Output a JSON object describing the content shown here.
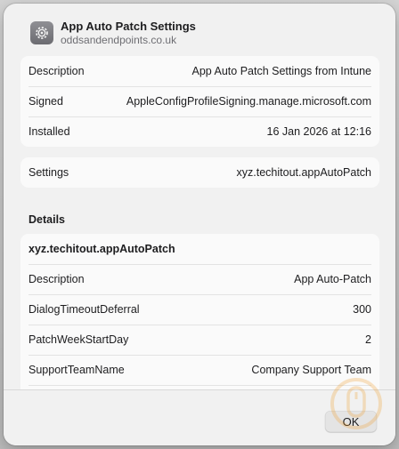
{
  "dialog": {
    "title": "App Auto Patch Settings",
    "subtitle": "oddsandendpoints.co.uk",
    "icon": "gear-icon"
  },
  "profile": {
    "rows": [
      {
        "label": "Description",
        "value": "App Auto Patch Settings from Intune"
      },
      {
        "label": "Signed",
        "value": "AppleConfigProfileSigning.manage.microsoft.com"
      },
      {
        "label": "Installed",
        "value": "16 Jan 2026 at 12:16"
      }
    ]
  },
  "settings": {
    "label": "Settings",
    "value": "xyz.techitout.appAutoPatch"
  },
  "details": {
    "section_title": "Details",
    "payload_name": "xyz.techitout.appAutoPatch",
    "rows": [
      {
        "label": "Description",
        "value": "App Auto-Patch"
      },
      {
        "label": "DialogTimeoutDeferral",
        "value": "300"
      },
      {
        "label": "PatchWeekStartDay",
        "value": "2"
      },
      {
        "label": "SupportTeamName",
        "value": "Company Support Team"
      }
    ]
  },
  "footer": {
    "ok_label": "OK"
  },
  "colors": {
    "accent": "#f0a030",
    "card_bg": "#fafafa",
    "sheet_bg": "#f1f1f1"
  }
}
